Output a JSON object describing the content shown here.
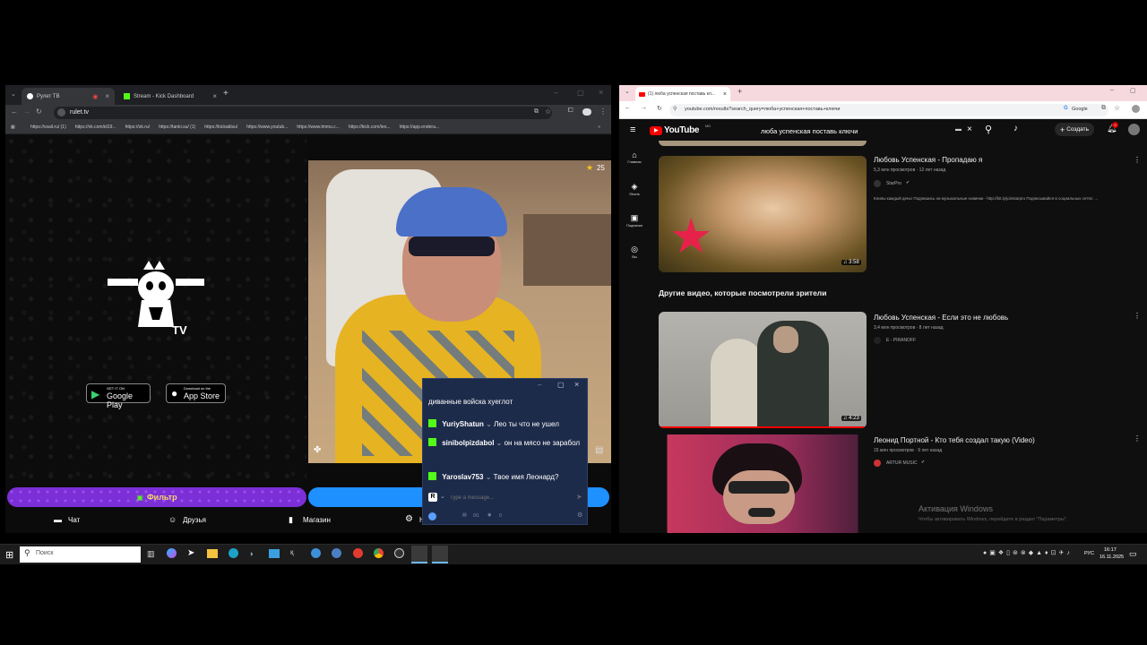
{
  "left_browser": {
    "tabs": [
      {
        "title": "Рулет ТВ",
        "active": true
      },
      {
        "title": "Stream - Kick Dashboard",
        "active": false
      }
    ],
    "address": "rulet.tv",
    "bookmarks": [
      "https://vsail.ru/ (1)",
      "https://vk.com/id19...",
      "https://ok.ru/",
      "https://tanki.su/ (1)",
      "https://kickablsu/",
      "https://www.youtub...",
      "https://www.tmmu.c...",
      "https://kick.com/leo...",
      "https://app.endera..."
    ]
  },
  "rulet_page": {
    "logo_text": "TV",
    "google_play": {
      "small": "GET IT ON",
      "big": "Google Play"
    },
    "app_store": {
      "small": "Download on the",
      "big": "App Store"
    },
    "viewer_count": "25",
    "filter_button": "Фильтр",
    "bottom_nav": [
      "Чат",
      "Друзья",
      "Магазин",
      "Н"
    ]
  },
  "chat_popup": {
    "header_text": "диванные войска хуеглот",
    "messages": [
      {
        "user": "YuriyShatun",
        "text": "Лео ты что не ушел"
      },
      {
        "user": "sinibolpizdabol",
        "text": "он на мясо не зарабол"
      },
      {
        "user": "Yaroslav753",
        "text": "Твое имя Леонард?"
      }
    ],
    "input_placeholder": "Type a message...",
    "footer_counts": [
      "0/1",
      "0"
    ],
    "avatar_letter": "R"
  },
  "right_browser": {
    "tab_title": "(1) люба успенская поставь кл...",
    "address": "youtube.com/results?search_query=люба+успенская+поставь+ключи",
    "google_label": "Google"
  },
  "youtube": {
    "logo_text": "YouTube",
    "logo_sup": "MD",
    "search_query": "люба успенская поставь ключи",
    "create_label": "Создать",
    "notif_count": "9",
    "sidebar": [
      "Главная",
      "Shorts",
      "Подписки",
      "Вы"
    ],
    "section_title": "Другие видео, которые посмотрели зрители",
    "videos": [
      {
        "title": "Любовь Успенская - Пропадаю я",
        "meta": "5,3 млн просмотров · 12 лет назад",
        "channel": "StarPro",
        "desc": "Клипы каждый день! Подпишись на музыкальные новинки - http://bit.ly/joinstarpro Подписывайся в социальных сетях: ...",
        "duration": "3:58"
      },
      {
        "title": "Любовь Успенская - Если это не любовь",
        "meta": "3,4 млн просмотров · 8 лет назад",
        "channel": "E - PIRANOFF",
        "duration": "4:23"
      },
      {
        "title": "Леонид Портной - Кто тебя создал такую (Video)",
        "meta": "15 млн просмотров · 9 лет назад",
        "channel": "ARTUR MUSIC",
        "duration": ""
      }
    ],
    "activation_title": "Активация Windows",
    "activation_text": "Чтобы активировать Windows, перейдите в раздел \"Параметры\"."
  },
  "taskbar": {
    "search_placeholder": "Поиск",
    "lang": "РУС",
    "time": "16:17",
    "date": "16.11.2025"
  },
  "colors": {
    "kick_green": "#53fc18",
    "chat_bg": "#1d2b4a",
    "youtube_red": "#ff0000",
    "purple_button": "#7b2fd6",
    "blue_button": "#1e90ff"
  }
}
